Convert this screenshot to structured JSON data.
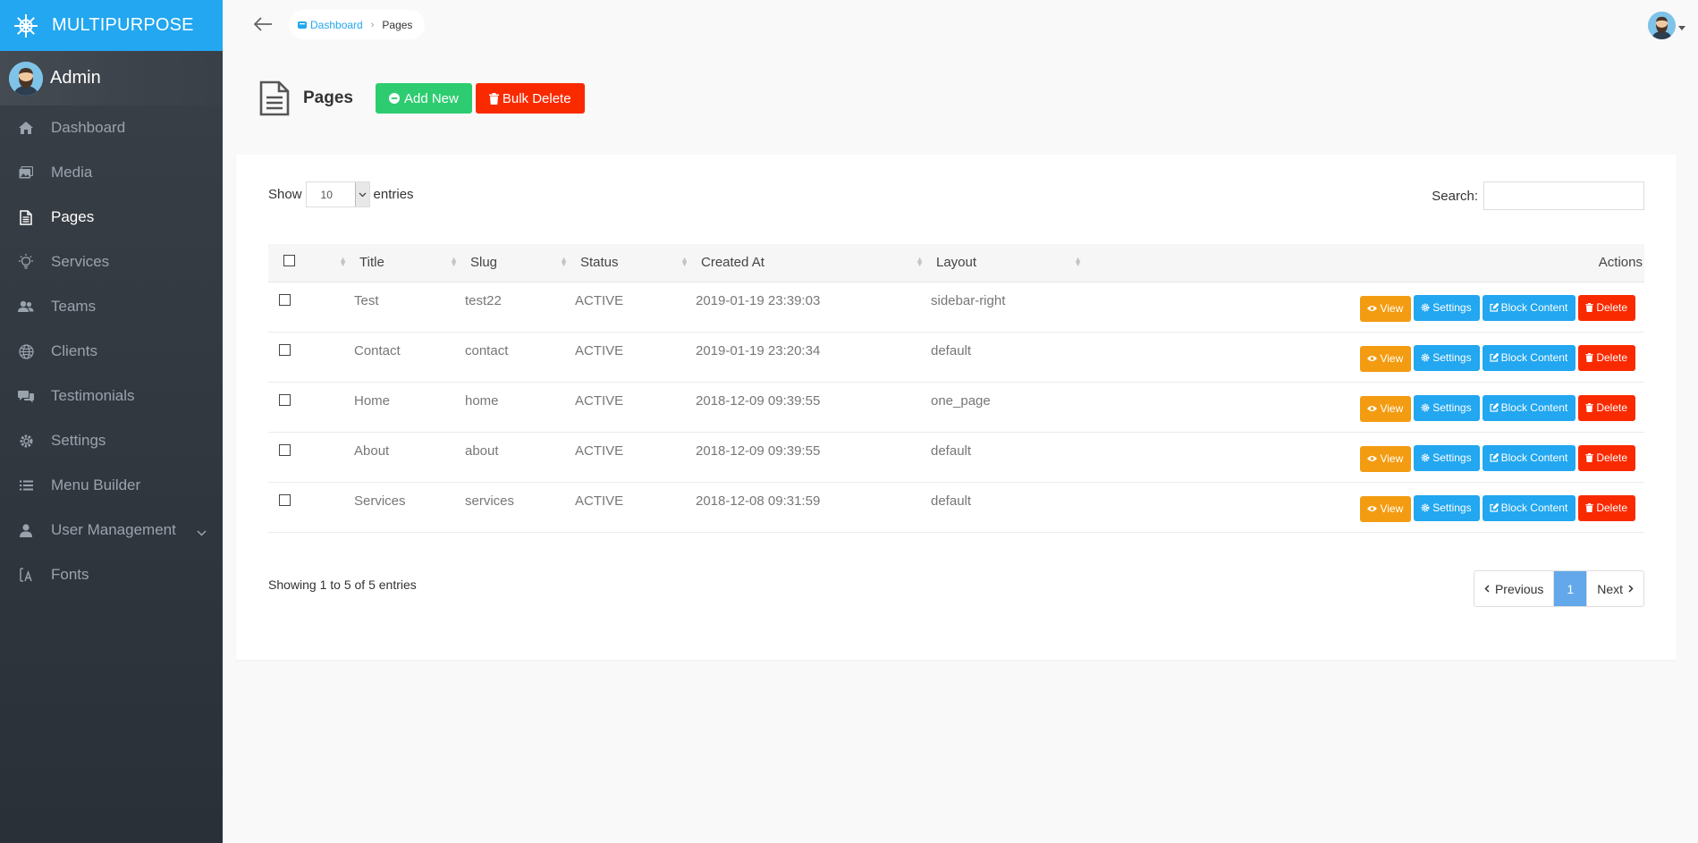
{
  "brand": {
    "name": "MULTIPURPOSE"
  },
  "profile": {
    "name": "Admin"
  },
  "sidebar": {
    "items": [
      {
        "label": "Dashboard",
        "icon": "home-icon"
      },
      {
        "label": "Media",
        "icon": "images-icon"
      },
      {
        "label": "Pages",
        "icon": "file-text-icon",
        "active": true
      },
      {
        "label": "Services",
        "icon": "lightbulb-icon"
      },
      {
        "label": "Teams",
        "icon": "people-icon"
      },
      {
        "label": "Clients",
        "icon": "globe-icon"
      },
      {
        "label": "Testimonials",
        "icon": "comments-icon"
      },
      {
        "label": "Settings",
        "icon": "gear-icon"
      },
      {
        "label": "Menu Builder",
        "icon": "list-icon"
      },
      {
        "label": "User Management",
        "icon": "person-icon"
      },
      {
        "label": "Fonts",
        "icon": "font-icon"
      }
    ]
  },
  "breadcrumb": {
    "home": "Dashboard",
    "current": "Pages"
  },
  "header": {
    "title": "Pages",
    "add_label": "Add New",
    "bulk_label": "Bulk Delete"
  },
  "table_controls": {
    "show_label": "Show",
    "entries_value": "10",
    "entries_label": "entries",
    "search_label": "Search:",
    "search_value": ""
  },
  "table": {
    "columns": [
      "Title",
      "Slug",
      "Status",
      "Created At",
      "Layout",
      "Actions"
    ],
    "rows": [
      {
        "title": "Test",
        "slug": "test22",
        "status": "ACTIVE",
        "created_at": "2019-01-19 23:39:03",
        "layout": "sidebar-right"
      },
      {
        "title": "Contact",
        "slug": "contact",
        "status": "ACTIVE",
        "created_at": "2019-01-19 23:20:34",
        "layout": "default"
      },
      {
        "title": "Home",
        "slug": "home",
        "status": "ACTIVE",
        "created_at": "2018-12-09 09:39:55",
        "layout": "one_page"
      },
      {
        "title": "About",
        "slug": "about",
        "status": "ACTIVE",
        "created_at": "2018-12-09 09:39:55",
        "layout": "default"
      },
      {
        "title": "Services",
        "slug": "services",
        "status": "ACTIVE",
        "created_at": "2018-12-08 09:31:59",
        "layout": "default"
      }
    ],
    "actions": {
      "view": "View",
      "settings": "Settings",
      "block_content": "Block Content",
      "delete": "Delete"
    }
  },
  "footer": {
    "info": "Showing 1 to 5 of 5 entries",
    "previous": "Previous",
    "page": "1",
    "next": "Next"
  },
  "colors": {
    "brand": "#22a7f0",
    "success": "#2ecc71",
    "danger": "#fa2a00",
    "warning": "#f39c12",
    "pager_active": "#62a8ea"
  }
}
